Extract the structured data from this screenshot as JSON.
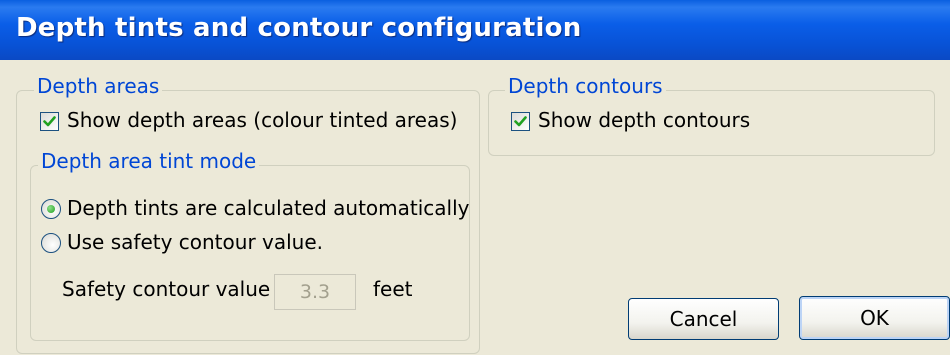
{
  "window": {
    "title": "Depth tints and contour configuration"
  },
  "depth_areas": {
    "legend": "Depth areas",
    "show_checkbox": {
      "label": "Show depth areas (colour tinted areas)",
      "checked": true
    },
    "tint_mode": {
      "legend": "Depth area tint mode",
      "options": [
        {
          "label": "Depth tints are calculated automatically",
          "selected": true
        },
        {
          "label": "Use safety contour value.",
          "selected": false
        }
      ],
      "safety_label": "Safety contour value",
      "safety_value": "3.3",
      "safety_unit": "feet"
    }
  },
  "depth_contours": {
    "legend": "Depth contours",
    "show_checkbox": {
      "label": "Show depth contours",
      "checked": true
    }
  },
  "buttons": {
    "cancel": "Cancel",
    "ok": "OK"
  },
  "colors": {
    "title_bar": "#0a5ee8",
    "legend_text": "#0046d5",
    "checkmark": "#21a121",
    "dialog_bg": "#ece9d8"
  }
}
